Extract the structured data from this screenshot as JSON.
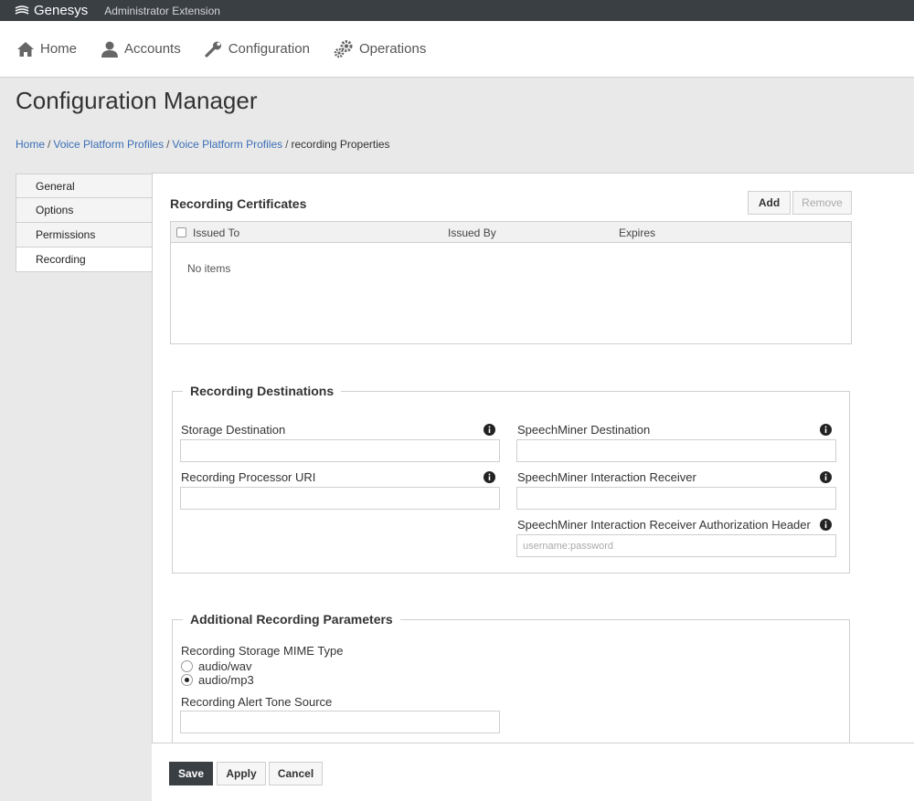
{
  "app": {
    "brand": "Genesys",
    "subtitle": "Administrator Extension"
  },
  "nav": {
    "items": [
      {
        "label": "Home",
        "icon": "home-icon"
      },
      {
        "label": "Accounts",
        "icon": "user-icon"
      },
      {
        "label": "Configuration",
        "icon": "wrench-icon"
      },
      {
        "label": "Operations",
        "icon": "gears-icon"
      }
    ]
  },
  "page": {
    "title": "Configuration Manager"
  },
  "breadcrumb": {
    "home": "Home",
    "profiles1": "Voice Platform Profiles",
    "profiles2": "Voice Platform Profiles",
    "current": "recording Properties",
    "sep": "/"
  },
  "sidebar": {
    "items": [
      {
        "label": "General"
      },
      {
        "label": "Options"
      },
      {
        "label": "Permissions"
      },
      {
        "label": "Recording",
        "active": true
      }
    ]
  },
  "certificates": {
    "title": "Recording Certificates",
    "add_label": "Add",
    "remove_label": "Remove",
    "columns": [
      "Issued To",
      "Issued By",
      "Expires"
    ],
    "empty_text": "No items"
  },
  "destinations": {
    "legend": "Recording Destinations",
    "storage_label": "Storage Destination",
    "storage_value": "",
    "processor_label": "Recording Processor URI",
    "processor_value": "",
    "sm_dest_label": "SpeechMiner Destination",
    "sm_dest_value": "",
    "sm_receiver_label": "SpeechMiner Interaction Receiver",
    "sm_receiver_value": "",
    "sm_auth_label": "SpeechMiner Interaction Receiver Authorization Header",
    "sm_auth_placeholder": "username:password"
  },
  "additional": {
    "legend": "Additional Recording Parameters",
    "mime_label": "Recording Storage MIME Type",
    "mime_options": [
      {
        "label": "audio/wav",
        "checked": false
      },
      {
        "label": "audio/mp3",
        "checked": true
      }
    ],
    "alert_label": "Recording Alert Tone Source",
    "alert_value": ""
  },
  "footer": {
    "save_label": "Save",
    "apply_label": "Apply",
    "cancel_label": "Cancel"
  },
  "colors": {
    "topbar": "#3a3f44",
    "link": "#3b6fb6",
    "primary_button": "#3a3f44"
  }
}
